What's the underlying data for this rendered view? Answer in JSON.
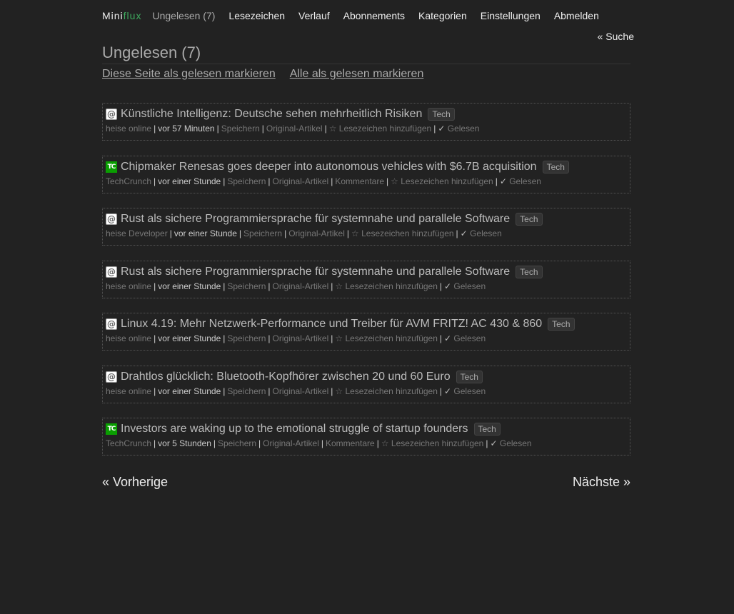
{
  "logo": {
    "part1": "Mini",
    "part2": "flux"
  },
  "nav": {
    "unread": "Ungelesen (7)",
    "bookmarks": "Lesezeichen",
    "history": "Verlauf",
    "subscriptions": "Abonnements",
    "categories": "Kategorien",
    "settings": "Einstellungen",
    "logout": "Abmelden"
  },
  "search_link": "« Suche",
  "page_title": "Ungelesen (7)",
  "actions": {
    "mark_page_read": "Diese Seite als gelesen markieren",
    "mark_all_read": "Alle als gelesen markieren"
  },
  "meta_labels": {
    "save": "Speichern",
    "original": "Original-Artikel",
    "comments": "Kommentare",
    "bookmark": "☆ Lesezeichen hinzufügen",
    "read_check": "✓",
    "read": "Gelesen"
  },
  "items": [
    {
      "favicon": "heise-icon",
      "title": "Künstliche Intelligenz: Deutsche sehen mehrheitlich Risiken",
      "tag": "Tech",
      "feed": "heise online",
      "time": "vor 57 Minuten",
      "has_comments": false
    },
    {
      "favicon": "techcrunch-icon",
      "title": "Chipmaker Renesas goes deeper into autonomous vehicles with $6.7B acquisition",
      "tag": "Tech",
      "feed": "TechCrunch",
      "time": "vor einer Stunde",
      "has_comments": true
    },
    {
      "favicon": "heise-icon",
      "title": "Rust als sichere Programmiersprache für systemnahe und parallele Software",
      "tag": "Tech",
      "feed": "heise Developer",
      "time": "vor einer Stunde",
      "has_comments": false
    },
    {
      "favicon": "heise-icon",
      "title": "Rust als sichere Programmiersprache für systemnahe und parallele Software",
      "tag": "Tech",
      "feed": "heise online",
      "time": "vor einer Stunde",
      "has_comments": false
    },
    {
      "favicon": "heise-icon",
      "title": "Linux 4.19: Mehr Netzwerk-Performance und Treiber für AVM FRITZ! AC 430 & 860",
      "tag": "Tech",
      "feed": "heise online",
      "time": "vor einer Stunde",
      "has_comments": false
    },
    {
      "favicon": "heise-icon",
      "title": "Drahtlos glücklich: Bluetooth-Kopfhörer zwischen 20 und 60 Euro",
      "tag": "Tech",
      "feed": "heise online",
      "time": "vor einer Stunde",
      "has_comments": false
    },
    {
      "favicon": "techcrunch-icon",
      "title": "Investors are waking up to the emotional struggle of startup founders",
      "tag": "Tech",
      "feed": "TechCrunch",
      "time": "vor 5 Stunden",
      "has_comments": true
    }
  ],
  "pagination": {
    "prev": "« Vorherige",
    "next": "Nächste »"
  },
  "colors": {
    "background": "#222222",
    "logo_accent": "#3eaa5e",
    "techcrunch_green": "#0a9e01"
  }
}
